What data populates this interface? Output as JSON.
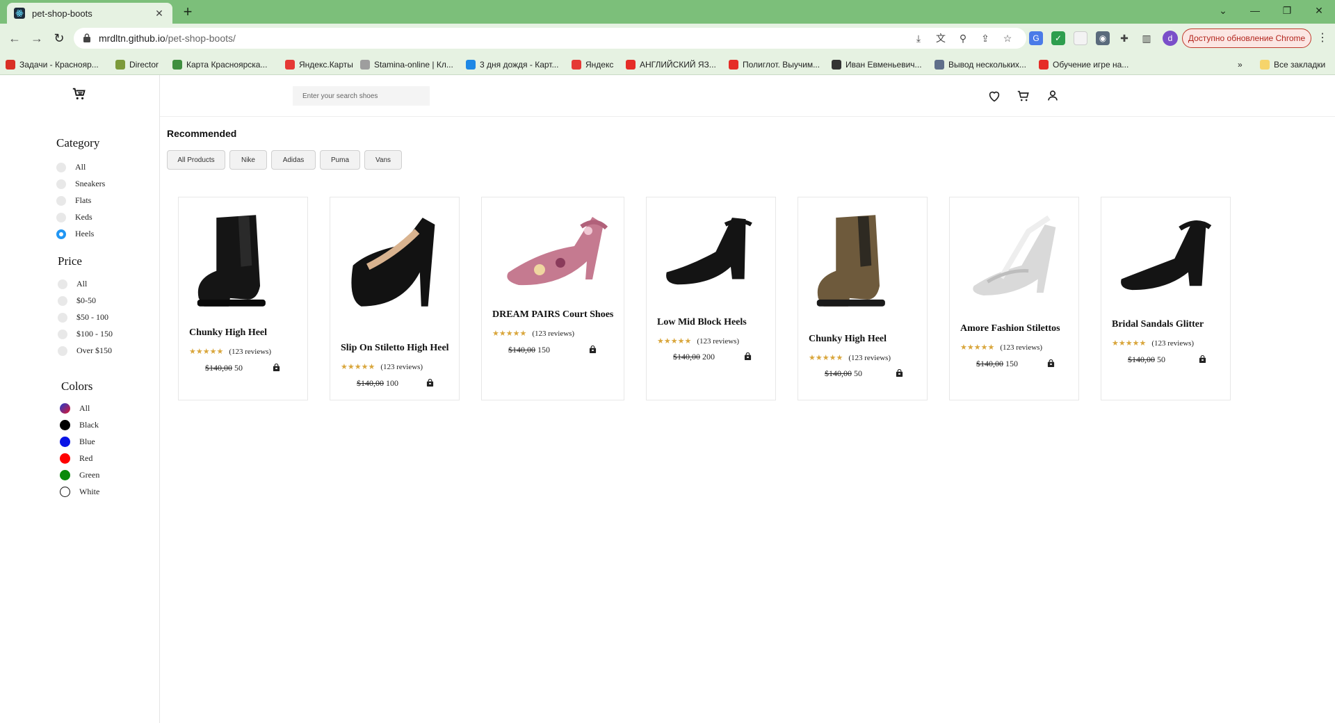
{
  "browser": {
    "tab_title": "pet-shop-boots",
    "tab_close": "✕",
    "new_tab": "+",
    "url_host": "mrdltn.github.io",
    "url_path": "/pet-shop-boots/",
    "update_button": "Доступно обновление Chrome",
    "profile_initial": "d",
    "bookmarks": [
      {
        "label": "Задачи - Краснояр...",
        "icon": "red-arc-icon",
        "color": "#d93025"
      },
      {
        "label": "Director",
        "icon": "director-icon",
        "color": "#7c9a3a"
      },
      {
        "label": "Карта Красноярска...",
        "icon": "map-icon",
        "color": "#3f8f3f"
      },
      {
        "label": "Яндекс.Карты",
        "icon": "pin-icon",
        "color": "#e53935"
      },
      {
        "label": "Stamina-online | Кл...",
        "icon": "page-icon",
        "color": "#9e9e9e"
      },
      {
        "label": "3 дня дождя - Карт...",
        "icon": "circle-icon",
        "color": "#1e88e5"
      },
      {
        "label": "Яндекс",
        "icon": "yandex-icon",
        "color": "#e53935"
      },
      {
        "label": "АНГЛИЙСКИЙ ЯЗ...",
        "icon": "youtube-icon",
        "color": "#e52d27"
      },
      {
        "label": "Полиглот. Выучим...",
        "icon": "youtube-icon",
        "color": "#e52d27"
      },
      {
        "label": "Иван Евменьевич...",
        "icon": "t-icon",
        "color": "#333333"
      },
      {
        "label": "Вывод нескольких...",
        "icon": "page-icon",
        "color": "#5f6f8a"
      },
      {
        "label": "Обучение игре на...",
        "icon": "youtube-icon",
        "color": "#e52d27"
      }
    ],
    "bookmarks_more": "»",
    "all_bookmarks": "Все закладки"
  },
  "sidebar": {
    "category_title": "Category",
    "categories": [
      {
        "label": "All",
        "checked": false
      },
      {
        "label": "Sneakers",
        "checked": false
      },
      {
        "label": "Flats",
        "checked": false
      },
      {
        "label": "Keds",
        "checked": false
      },
      {
        "label": "Heels",
        "checked": true
      }
    ],
    "price_title": "Price",
    "prices": [
      {
        "label": "All"
      },
      {
        "label": "$0-50"
      },
      {
        "label": "$50 - 100"
      },
      {
        "label": "$100 - 150"
      },
      {
        "label": "Over $150"
      }
    ],
    "colors_title": "Colors",
    "colors": [
      {
        "label": "All",
        "swatch": "linear-gradient(135deg,#1c3bd0,#e0162b)"
      },
      {
        "label": "Black",
        "swatch": "#000000"
      },
      {
        "label": "Blue",
        "swatch": "#0a14e6"
      },
      {
        "label": "Red",
        "swatch": "#ff0000"
      },
      {
        "label": "Green",
        "swatch": "#0a8a0a"
      },
      {
        "label": "White",
        "swatch": "#ffffff"
      }
    ]
  },
  "header": {
    "search_placeholder": "Enter your search shoes"
  },
  "main": {
    "title": "Recommended",
    "filters": [
      "All Products",
      "Nike",
      "Adidas",
      "Puma",
      "Vans"
    ],
    "stars": "★★★★★",
    "products": [
      {
        "name": "Chunky High Heel",
        "reviews": "(123 reviews)",
        "old_price": "$140,00",
        "price": "50",
        "shoe": "black-chelsea-boot"
      },
      {
        "name": "Slip On Stiletto High Heel",
        "reviews": "(123 reviews)",
        "old_price": "$140,00",
        "price": "100",
        "shoe": "black-platform-pump"
      },
      {
        "name": "DREAM PAIRS Court Shoes",
        "reviews": "(123 reviews)",
        "old_price": "$140,00",
        "price": "150",
        "shoe": "floral-ankle-strap-pump"
      },
      {
        "name": "Low Mid Block Heels",
        "reviews": "(123 reviews)",
        "old_price": "$140,00",
        "price": "200",
        "shoe": "black-block-heel"
      },
      {
        "name": "Chunky High Heel",
        "reviews": "(123 reviews)",
        "old_price": "$140,00",
        "price": "50",
        "shoe": "brown-chelsea-boot"
      },
      {
        "name": "Amore Fashion Stilettos",
        "reviews": "(123 reviews)",
        "old_price": "$140,00",
        "price": "150",
        "shoe": "silver-t-strap-sandal"
      },
      {
        "name": "Bridal Sandals Glitter",
        "reviews": "(123 reviews)",
        "old_price": "$140,00",
        "price": "50",
        "shoe": "black-ankle-strap-heel"
      }
    ]
  }
}
